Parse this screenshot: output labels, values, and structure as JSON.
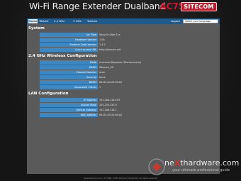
{
  "header": {
    "title": "Wi-Fi Range Extender Dualband",
    "model": "AC750",
    "brand": "SITECOM"
  },
  "nav": {
    "tabs": [
      "Home",
      "Wizard",
      "2.4 GHz Wireless",
      "5 GHz Wireless",
      "Toolbox"
    ],
    "logout": "Logout",
    "language": "Select your language"
  },
  "system": {
    "title": "System",
    "rows": [
      {
        "label": "Up Time",
        "value": "0day:0h:16m:21s"
      },
      {
        "label": "Hardware Version",
        "value": "1.0A"
      },
      {
        "label": "Runtime Code Version",
        "value": "1.4.2"
      },
      {
        "label": "Quick access URL",
        "value": "http://sitecom.net"
      }
    ]
  },
  "wireless24": {
    "title": "2.4 GHz Wireless Configuration",
    "rows": [
      {
        "label": "Mode",
        "value": "Universal Repeater (Disconnected)"
      },
      {
        "label": "ESSID",
        "value": "Sitecom_5G"
      },
      {
        "label": "Channel Number",
        "value": "Auto"
      },
      {
        "label": "Security",
        "value": "None"
      },
      {
        "label": "BSSID",
        "value": "64:D1:A3:22:65:A2"
      },
      {
        "label": "Associated Clients",
        "value": "1"
      }
    ]
  },
  "lan": {
    "title": "LAN Configuration",
    "rows": [
      {
        "label": "IP Address",
        "value": "192.168.128.233"
      },
      {
        "label": "Subnet Mask",
        "value": "255.255.255.0"
      },
      {
        "label": "Default Gateway",
        "value": "192.168.128.1"
      },
      {
        "label": "MAC Address",
        "value": "64:D1:A3:22:65:A2"
      }
    ]
  },
  "footer": "www.sitecom.com  |  © 1996 - 2014 Sitecom Europe BV, all rights reserved",
  "watermark": {
    "text_a": "ne",
    "text_x": "X",
    "text_b": "thardware.com",
    "sub": "your ultimate professional guide"
  }
}
